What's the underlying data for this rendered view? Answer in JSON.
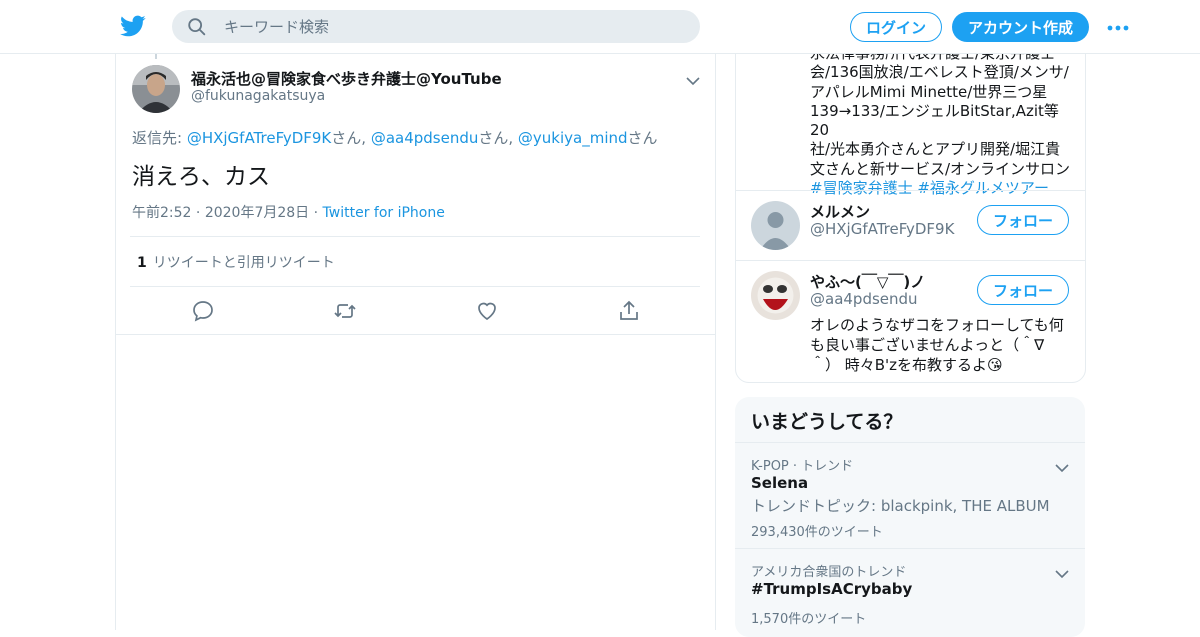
{
  "colors": {
    "accent": "#1da1f2",
    "link": "#1b95e0",
    "muted": "#657786",
    "border": "#e6ecf0",
    "text": "#14171a"
  },
  "header": {
    "logo_icon": "twitter-bird-icon",
    "search_placeholder": "キーワード検索",
    "login_label": "ログイン",
    "signup_label": "アカウント作成",
    "more_icon": "more-dots-icon"
  },
  "tweet": {
    "author_name": "福永活也@冒険家食べ歩き弁護士@YouTube",
    "author_handle": "@fukunagakatsuya",
    "reply_prefix": "返信先: ",
    "reply_mentions": [
      {
        "handle": "@HXjGfATreFyDF9K",
        "suffix": "さん, "
      },
      {
        "handle": "@aa4pdsendu",
        "suffix": "さん, "
      },
      {
        "handle": "@yukiya_mind",
        "suffix": "さん"
      }
    ],
    "text": "消えろ、カス",
    "time": "午前2:52",
    "date": "2020年7月28日",
    "source": "Twitter for iPhone",
    "retweet_count": "1",
    "retweet_label": "リツイートと引用リツイート",
    "actions": [
      "reply-icon",
      "retweet-icon",
      "like-icon",
      "share-icon"
    ]
  },
  "sidebar": {
    "bio_lines": [
      "永法律事務所代表弁護士/東京弁護士",
      "会/136国放浪/エベレスト登頂/メンサ/",
      "アパレルMimi Minette/世界三つ星",
      "139→133/エンジェルBitStar,Azit等20",
      "社/光本勇介さんとアプリ開発/堀江貴",
      "文さんと新サービス/オンラインサロン"
    ],
    "bio_tags": [
      "#冒険家弁護士",
      "#福永グルメツアー"
    ],
    "users": [
      {
        "name": "メルメン",
        "handle": "@HXjGfATreFyDF9K",
        "follow_label": "フォロー",
        "bio": ""
      },
      {
        "name": "やふ〜(￣▽￣)ノ",
        "handle": "@aa4pdsendu",
        "follow_label": "フォロー",
        "bio": "オレのようなザコをフォローしても何も良い事ございませんよっと（＾∇＾） 時々B'zを布教するよ😘"
      }
    ]
  },
  "trends": {
    "title": "いまどうしてる？",
    "items": [
      {
        "context": "K-POP · トレンド",
        "name": "Selena",
        "desc": "トレンドトピック: blackpink, THE ALBUM",
        "count": "293,430件のツイート"
      },
      {
        "context": "アメリカ合衆国のトレンド",
        "name": "#TrumpIsACrybaby",
        "desc": "",
        "count": "1,570件のツイート"
      }
    ]
  }
}
